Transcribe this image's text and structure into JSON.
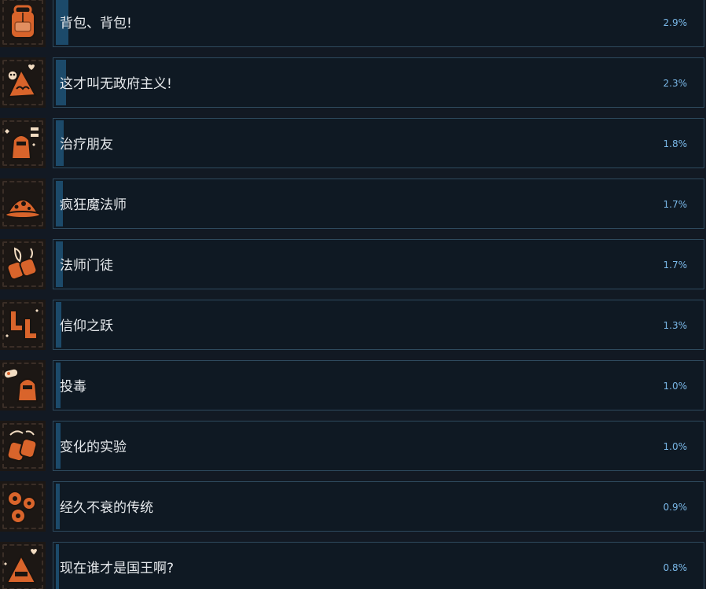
{
  "achievements": [
    {
      "name": "背包、背包!",
      "percent_label": "2.9%",
      "percent": 2.9,
      "icon": "backpack-icon"
    },
    {
      "name": "这才叫无政府主义!",
      "percent_label": "2.3%",
      "percent": 2.3,
      "icon": "hooded-skull-icon"
    },
    {
      "name": "治疗朋友",
      "percent_label": "1.8%",
      "percent": 1.8,
      "icon": "knight-heal-icon"
    },
    {
      "name": "疯狂魔法师",
      "percent_label": "1.7%",
      "percent": 1.7,
      "icon": "wizard-hat-icon"
    },
    {
      "name": "法师门徒",
      "percent_label": "1.7%",
      "percent": 1.7,
      "icon": "mage-gloves-icon"
    },
    {
      "name": "信仰之跃",
      "percent_label": "1.3%",
      "percent": 1.3,
      "icon": "boots-icon"
    },
    {
      "name": "投毒",
      "percent_label": "1.0%",
      "percent": 1.0,
      "icon": "poison-knight-icon"
    },
    {
      "name": "变化的实验",
      "percent_label": "1.0%",
      "percent": 1.0,
      "icon": "transform-gloves-icon"
    },
    {
      "name": "经久不衰的传统",
      "percent_label": "0.9%",
      "percent": 0.9,
      "icon": "flowers-icon"
    },
    {
      "name": "现在谁才是国王啊?",
      "percent_label": "0.8%",
      "percent": 0.8,
      "icon": "king-hood-icon"
    }
  ],
  "colors": {
    "background": "#121923",
    "card": "#0f1923",
    "card_border": "#2e4a5e",
    "progress": "#1c4a6a",
    "title_text": "#e6e9ec",
    "percent_text": "#7ab8e8",
    "icon_orange": "#d9642b"
  }
}
